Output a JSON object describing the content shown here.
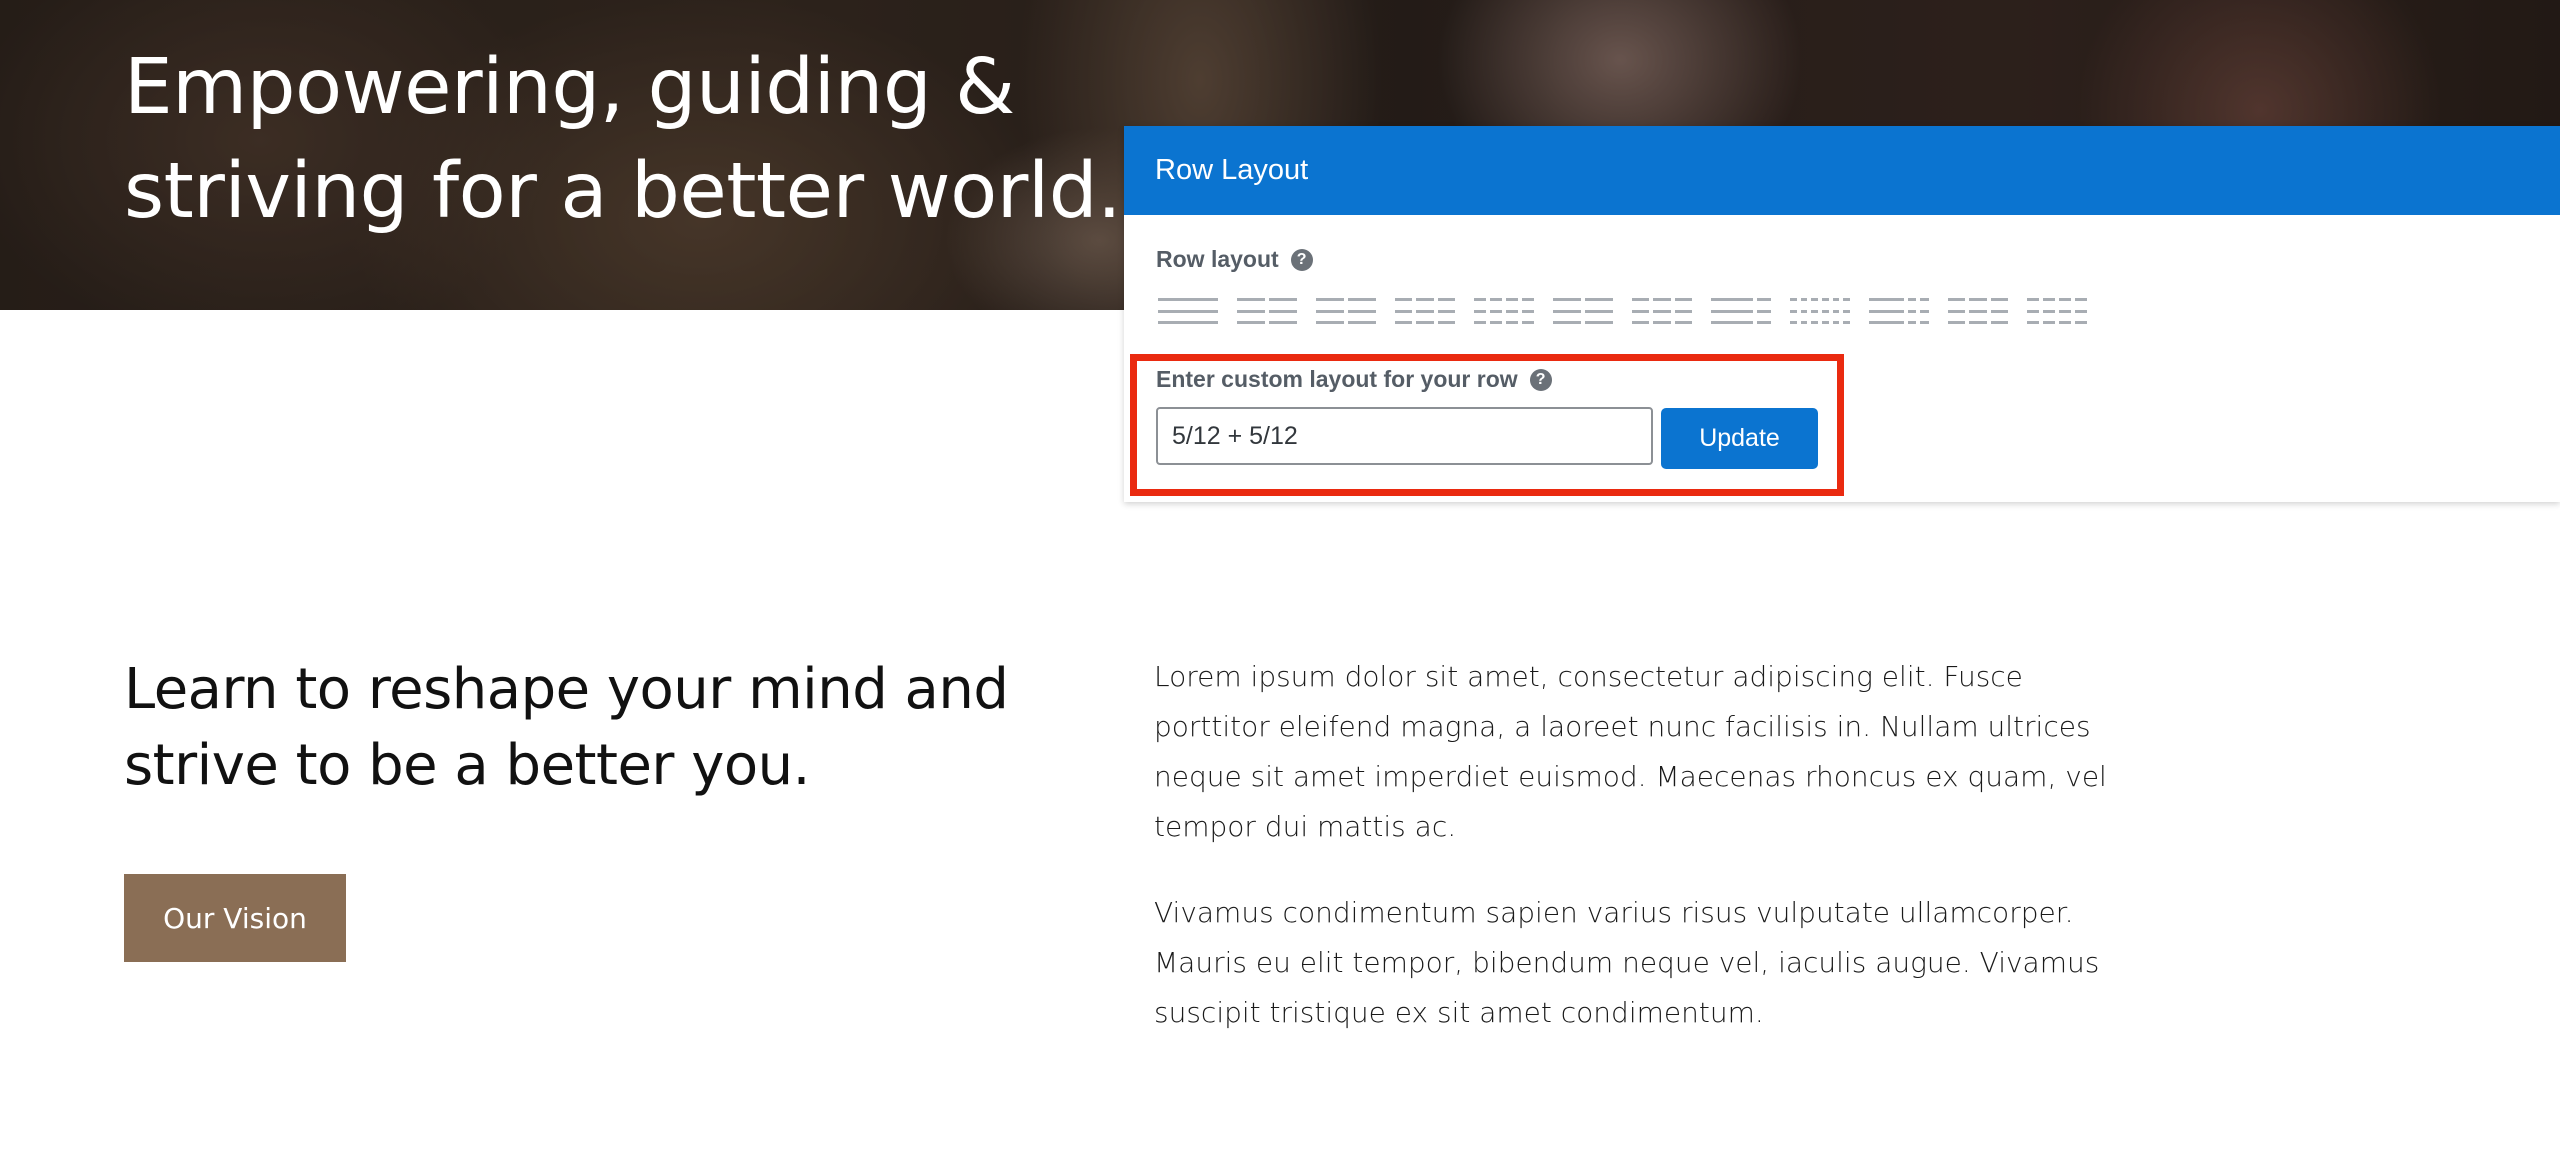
{
  "hero": {
    "title": "Empowering, guiding & striving for a better world."
  },
  "row_layout_panel": {
    "title": "Row Layout",
    "row_layout_label": "Row layout",
    "help_glyph": "?",
    "layout_options": [
      {
        "icon": "layout-1-col-icon",
        "columns": [
          12
        ]
      },
      {
        "icon": "layout-2-col-icon",
        "columns": [
          6,
          6
        ]
      },
      {
        "icon": "layout-2-col-icon",
        "columns": [
          6,
          6
        ]
      },
      {
        "icon": "layout-3-col-icon",
        "columns": [
          4,
          4,
          4
        ]
      },
      {
        "icon": "layout-4-col-icon",
        "columns": [
          3,
          3,
          3,
          3
        ]
      },
      {
        "icon": "layout-2-col-icon",
        "columns": [
          6,
          6
        ]
      },
      {
        "icon": "layout-3-col-icon",
        "columns": [
          4,
          4,
          4
        ]
      },
      {
        "icon": "layout-2-col-uneven-icon",
        "columns": [
          9,
          3
        ]
      },
      {
        "icon": "layout-6-col-icon",
        "columns": [
          2,
          2,
          2,
          2,
          2,
          2
        ]
      },
      {
        "icon": "layout-3-col-uneven-icon",
        "columns": [
          8,
          2,
          2
        ]
      },
      {
        "icon": "layout-3-col-icon",
        "columns": [
          4,
          4,
          4
        ]
      },
      {
        "icon": "layout-4-col-icon",
        "columns": [
          3,
          3,
          3,
          3
        ]
      }
    ],
    "custom_label": "Enter custom layout for your row",
    "custom_value": "5/12 + 5/12",
    "update_label": "Update",
    "highlight_color": "#ea2a10",
    "accent_color": "#0b74d0"
  },
  "content": {
    "heading": "Learn to reshape your mind and strive to be a better you.",
    "cta_label": "Our Vision",
    "cta_color": "#8a6e55",
    "paragraphs": [
      "Lorem ipsum dolor sit amet, consectetur adipiscing elit. Fusce porttitor eleifend magna, a laoreet nunc facilisis in. Nullam ultrices neque sit amet imperdiet euismod. Maecenas rhoncus ex quam, vel tempor dui mattis ac.",
      "Vivamus condimentum sapien varius risus vulputate ullamcorper. Mauris eu elit tempor, bibendum neque vel, iaculis augue. Vivamus suscipit tristique ex sit amet condimentum."
    ]
  }
}
